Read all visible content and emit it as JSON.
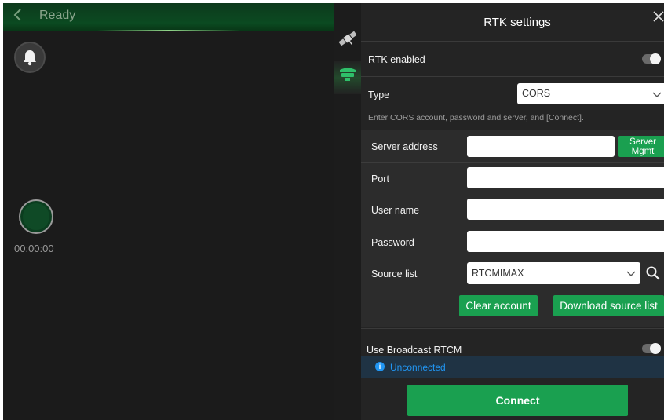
{
  "camera": {
    "status": "Ready",
    "timer": "00:00:00"
  },
  "panel": {
    "title": "RTK settings",
    "rtk_enabled_label": "RTK enabled",
    "type_label": "Type",
    "type_value": "CORS",
    "hint": "Enter CORS account, password and server, and [Connect].",
    "server_address_label": "Server address",
    "server_mgmt_label_line1": "Server",
    "server_mgmt_label_line2": "Mgmt",
    "port_label": "Port",
    "user_name_label": "User name",
    "password_label": "Password",
    "source_list_label": "Source list",
    "source_list_value": "RTCMIMAX",
    "clear_account_label": "Clear account",
    "download_source_list_label": "Download source list",
    "broadcast_label": "Use Broadcast RTCM",
    "connection_status": "Unconnected",
    "connect_label": "Connect"
  },
  "colors": {
    "accent": "#1aa050",
    "status_blue": "#2196f3",
    "panel_bg": "#242424"
  },
  "icons": [
    "back-arrow-icon",
    "bell-icon",
    "satellite-icon",
    "rtk-receiver-icon",
    "close-icon",
    "chevron-down-icon",
    "search-icon",
    "info-icon"
  ]
}
